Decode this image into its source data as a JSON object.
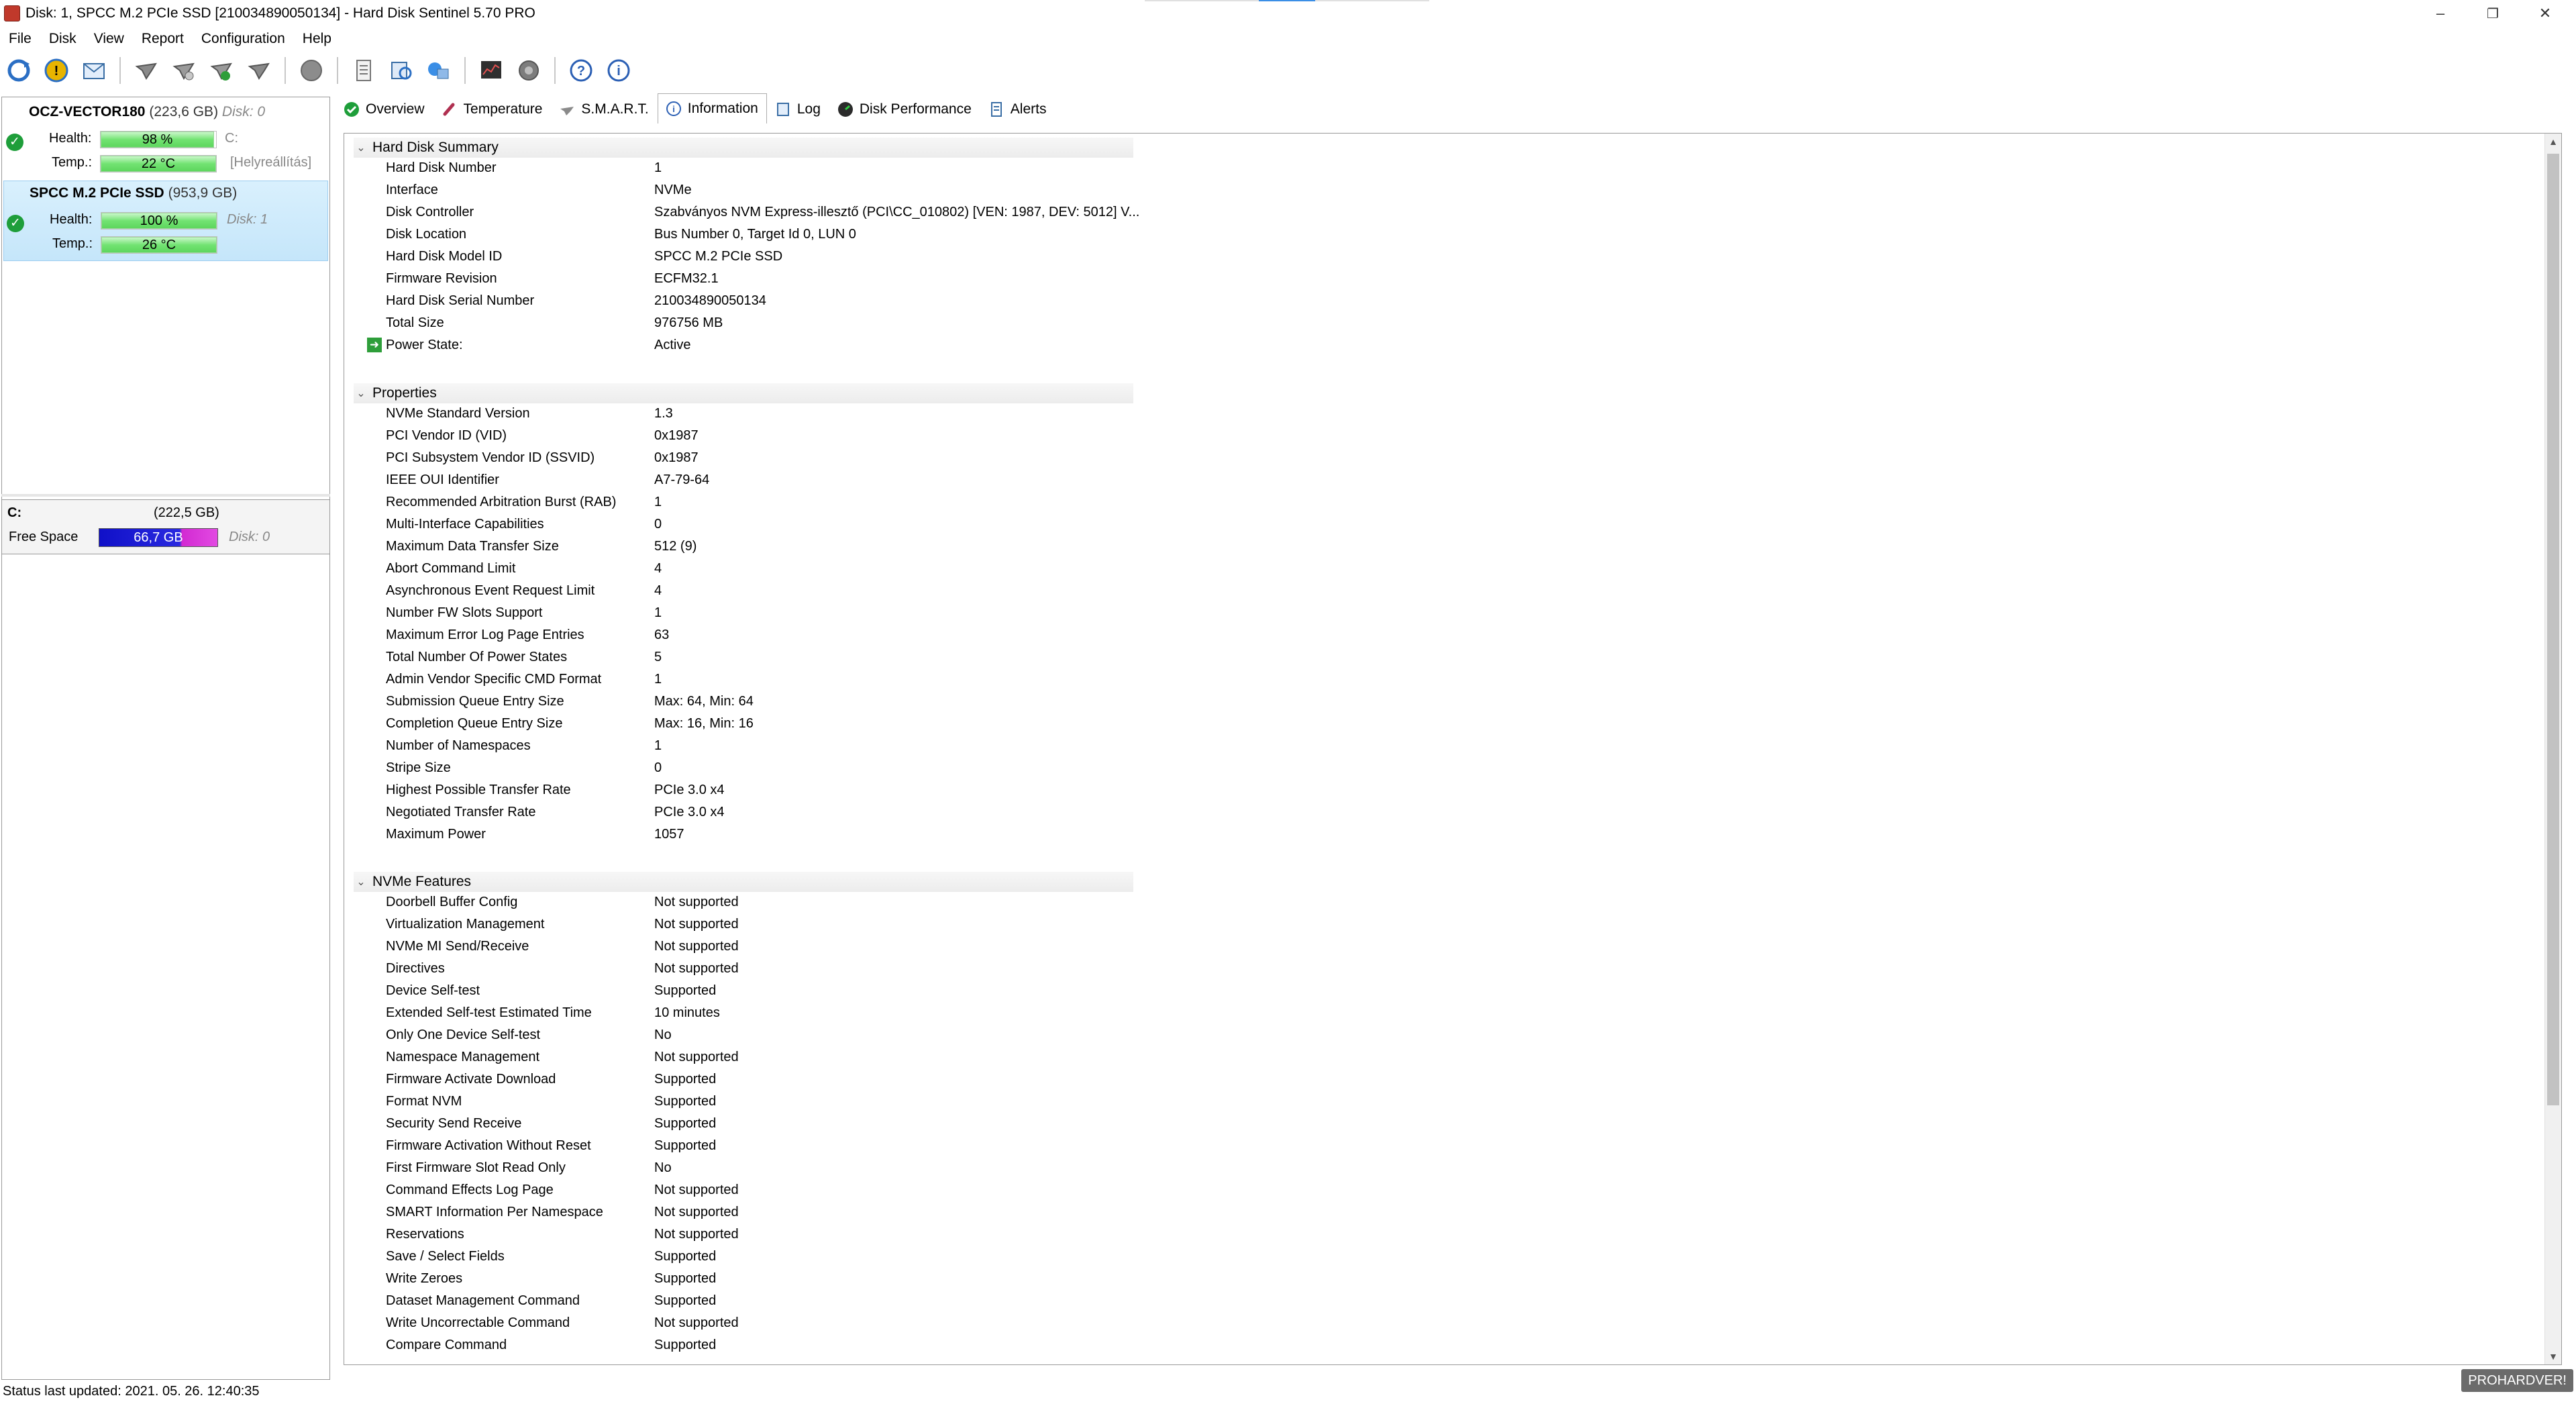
{
  "window": {
    "title": "Disk: 1, SPCC M.2 PCIe SSD [210034890050134]  -  Hard Disk Sentinel 5.70 PRO",
    "minimize": "–",
    "restore": "❐",
    "close": "✕"
  },
  "menu": [
    "File",
    "Disk",
    "View",
    "Report",
    "Configuration",
    "Help"
  ],
  "toolbar": {
    "icons": [
      "refresh-icon",
      "alert-icon",
      "mail-icon",
      "disk-tool-1-icon",
      "disk-tool-2-icon",
      "disk-tool-3-icon",
      "disk-tool-4-icon",
      "gray-circle-icon",
      "report-icon",
      "refresh-report-icon",
      "network-icon",
      "chart-icon",
      "shield-icon",
      "help-icon",
      "info-icon"
    ]
  },
  "disks": [
    {
      "name": "OCZ-VECTOR180",
      "size": "(223,6 GB)",
      "disk": "Disk: 0",
      "health_label": "Health:",
      "health": "98 %",
      "health_pct": 98,
      "drive_letter": "C:",
      "temp_label": "Temp.:",
      "temp": "22 °C",
      "note": "[Helyreállítás]"
    },
    {
      "name": "SPCC M.2 PCIe SSD",
      "size": "(953,9 GB)",
      "disk": "Disk: 1",
      "health_label": "Health:",
      "health": "100 %",
      "health_pct": 100,
      "temp_label": "Temp.:",
      "temp": "26 °C"
    }
  ],
  "volume": {
    "letter": "C:",
    "size": "(222,5 GB)",
    "free_label": "Free Space",
    "free": "66,7 GB",
    "disk": "Disk: 0"
  },
  "tabs": [
    "Overview",
    "Temperature",
    "S.M.A.R.T.",
    "Information",
    "Log",
    "Disk Performance",
    "Alerts"
  ],
  "active_tab": "Information",
  "sections": [
    {
      "title": "Hard Disk Summary",
      "rows": [
        [
          "Hard Disk Number",
          "1"
        ],
        [
          "Interface",
          "NVMe"
        ],
        [
          "Disk Controller",
          "Szabványos NVM Express-illesztő (PCI\\CC_010802) [VEN: 1987, DEV: 5012] V..."
        ],
        [
          "Disk Location",
          "Bus Number 0, Target Id 0, LUN 0"
        ],
        [
          "Hard Disk Model ID",
          "SPCC M.2 PCIe SSD"
        ],
        [
          "Firmware Revision",
          "ECFM32.1"
        ],
        [
          "Hard Disk Serial Number",
          "210034890050134"
        ],
        [
          "Total Size",
          "976756 MB"
        ],
        [
          "Power State:",
          "Active"
        ]
      ]
    },
    {
      "title": "Properties",
      "rows": [
        [
          "NVMe Standard Version",
          "1.3"
        ],
        [
          "PCI Vendor ID (VID)",
          "0x1987"
        ],
        [
          "PCI Subsystem Vendor ID (SSVID)",
          "0x1987"
        ],
        [
          "IEEE OUI Identifier",
          "A7-79-64"
        ],
        [
          "Recommended Arbitration Burst (RAB)",
          "1"
        ],
        [
          "Multi-Interface Capabilities",
          "0"
        ],
        [
          "Maximum Data Transfer Size",
          "512 (9)"
        ],
        [
          "Abort Command Limit",
          "4"
        ],
        [
          "Asynchronous Event Request Limit",
          "4"
        ],
        [
          "Number FW Slots Support",
          "1"
        ],
        [
          "Maximum Error Log Page Entries",
          "63"
        ],
        [
          "Total Number Of Power States",
          "5"
        ],
        [
          "Admin Vendor Specific CMD Format",
          "1"
        ],
        [
          "Submission Queue Entry Size",
          "Max: 64, Min: 64"
        ],
        [
          "Completion Queue Entry Size",
          "Max: 16, Min: 16"
        ],
        [
          "Number of Namespaces",
          "1"
        ],
        [
          "Stripe Size",
          "0"
        ],
        [
          "Highest Possible Transfer Rate",
          "PCIe 3.0 x4"
        ],
        [
          "Negotiated Transfer Rate",
          "PCIe 3.0 x4"
        ],
        [
          "Maximum Power",
          "1057"
        ]
      ]
    },
    {
      "title": "NVMe Features",
      "rows": [
        [
          "Doorbell Buffer Config",
          "Not supported"
        ],
        [
          "Virtualization Management",
          "Not supported"
        ],
        [
          "NVMe MI Send/Receive",
          "Not supported"
        ],
        [
          "Directives",
          "Not supported"
        ],
        [
          "Device Self-test",
          "Supported"
        ],
        [
          "Extended Self-test Estimated Time",
          "10 minutes"
        ],
        [
          "Only One Device Self-test",
          "No"
        ],
        [
          "Namespace Management",
          "Not supported"
        ],
        [
          "Firmware Activate Download",
          "Supported"
        ],
        [
          "Format NVM",
          "Supported"
        ],
        [
          "Security Send Receive",
          "Supported"
        ],
        [
          "Firmware Activation Without Reset",
          "Supported"
        ],
        [
          "First Firmware Slot Read Only",
          "No"
        ],
        [
          "Command Effects Log Page",
          "Not supported"
        ],
        [
          "SMART Information Per Namespace",
          "Not supported"
        ],
        [
          "Reservations",
          "Not supported"
        ],
        [
          "Save / Select Fields",
          "Supported"
        ],
        [
          "Write Zeroes",
          "Supported"
        ],
        [
          "Dataset Management Command",
          "Supported"
        ],
        [
          "Write Uncorrectable Command",
          "Not supported"
        ],
        [
          "Compare Command",
          "Supported"
        ]
      ]
    }
  ],
  "status": "Status last updated: 2021. 05. 26. 12:40:35",
  "watermark": "PROHARDVER!"
}
